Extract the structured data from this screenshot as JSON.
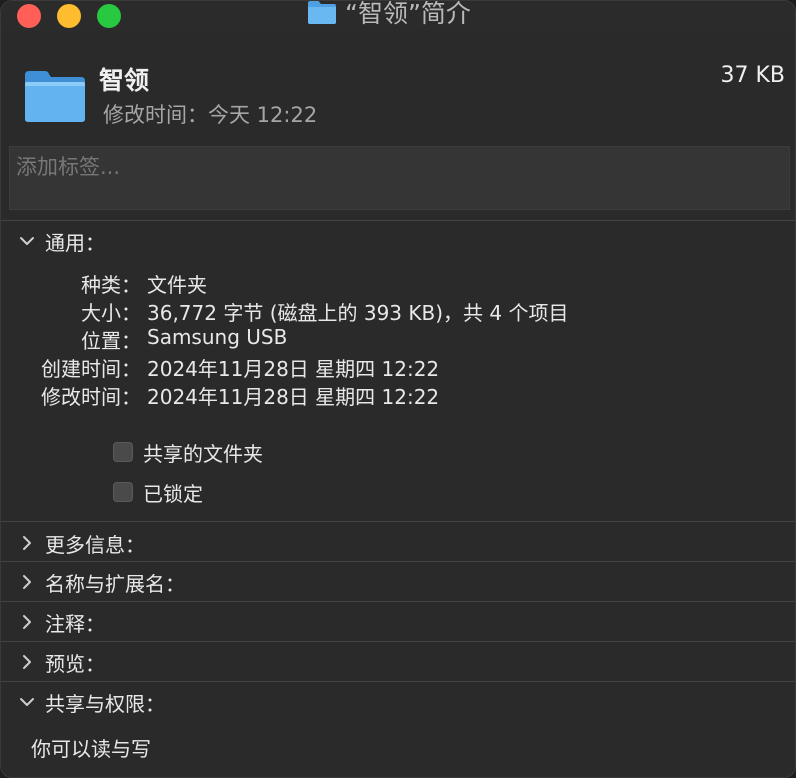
{
  "window": {
    "title": "“智领”简介"
  },
  "header": {
    "name": "智领",
    "modified": "修改时间：今天 12:22",
    "size": "37 KB"
  },
  "tags": {
    "placeholder": "添加标签..."
  },
  "general": {
    "heading": "通用：",
    "rows": [
      {
        "label": "种类：",
        "value": "文件夹"
      },
      {
        "label": "大小：",
        "value": "36,772 字节 (磁盘上的 393 KB)，共 4 个项目"
      },
      {
        "label": "位置：",
        "value": "Samsung USB"
      },
      {
        "label": "创建时间：",
        "value": "2024年11月28日 星期四 12:22"
      },
      {
        "label": "修改时间：",
        "value": "2024年11月28日 星期四 12:22"
      }
    ],
    "shared_folder_label": "共享的文件夹",
    "locked_label": "已锁定"
  },
  "sections": {
    "more_info": "更多信息：",
    "name_ext": "名称与扩展名：",
    "comments": "注释：",
    "preview": "预览：",
    "sharing": "共享与权限："
  },
  "sharing": {
    "permission_text": "你可以读与写"
  },
  "colors": {
    "folder_blue": "#5aa9ea",
    "close": "#ff5f57",
    "minimize": "#febc2e",
    "zoom": "#28c840"
  },
  "icons": {
    "folder": "folder-icon",
    "chevron_down": "chevron-down-icon",
    "chevron_right": "chevron-right-icon"
  }
}
